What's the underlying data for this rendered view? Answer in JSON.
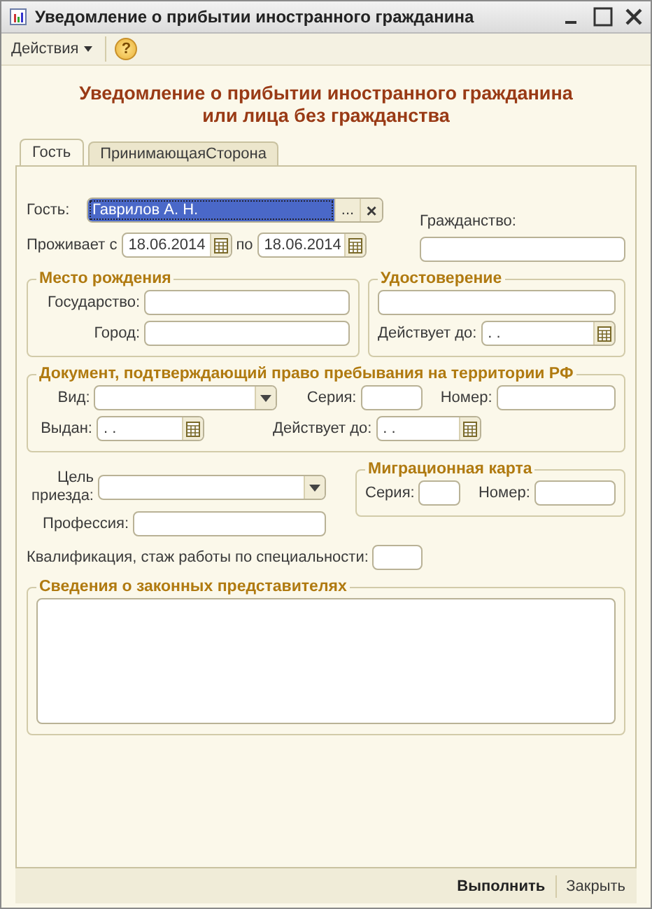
{
  "window": {
    "title": "Уведомление о прибытии иностранного гражданина"
  },
  "toolbar": {
    "actions": "Действия",
    "help": "?"
  },
  "heading": [
    "Уведомление о прибытии иностранного гражданина",
    "или лица без гражданства"
  ],
  "tabs": [
    {
      "label": "Гость",
      "selected": true
    },
    {
      "label": "ПринимающаяСторона",
      "selected": false
    }
  ],
  "guest": {
    "label": "Гость:",
    "value": "Гаврилов А. Н.",
    "selected": true,
    "select_button": "...",
    "clear_button": "×"
  },
  "stay": {
    "label": "Проживает с",
    "from": "18.06.2014",
    "to_label": "по",
    "to": "18.06.2014"
  },
  "citizenship": {
    "label": "Гражданство:"
  },
  "birthplace": {
    "title": "Место рождения",
    "country_label": "Государство:",
    "city_label": "Город:"
  },
  "id_document": {
    "title": "Удостоверение",
    "valid_label": "Действует до:",
    "valid_value": ". ."
  },
  "residence_document": {
    "title": "Документ, подтверждающий право пребывания на территории РФ",
    "type_label": "Вид:",
    "series_label": "Серия:",
    "number_label": "Номер:",
    "issued_label": "Выдан:",
    "issued_value": ". .",
    "valid_label": "Действует до:",
    "valid_value": ". ."
  },
  "purpose": {
    "label": "Цель приезда:"
  },
  "profession": {
    "label": "Профессия:"
  },
  "migration_card": {
    "title": "Миграционная карта",
    "series_label": "Серия:",
    "number_label": "Номер:"
  },
  "qualification": {
    "label": "Квалификация, стаж работы по специальности:"
  },
  "representatives": {
    "title": "Сведения о законных представителях"
  },
  "buttons": [
    {
      "label": "Выполнить",
      "default": true
    },
    {
      "label": "Закрыть",
      "default": false
    }
  ]
}
